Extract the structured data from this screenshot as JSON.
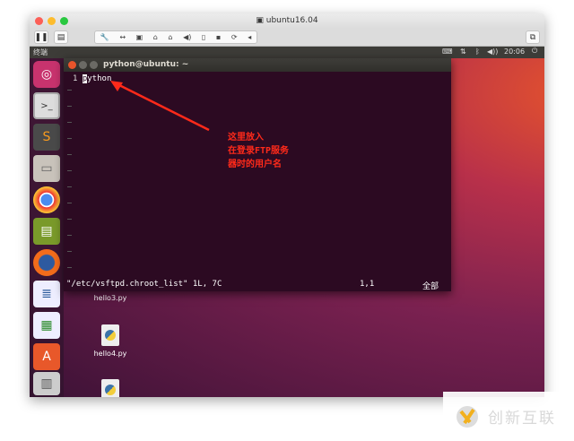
{
  "window": {
    "title": "ubuntu16.04"
  },
  "panel": {
    "app_name": "终端",
    "time": "20:06"
  },
  "terminal": {
    "title": "python@ubuntu: ~",
    "line_number": "1",
    "line_cursor_char": "p",
    "line_rest": "ython",
    "status_file": "\"/etc/vsftpd.chroot_list\" 1L, 7C",
    "status_pos": "1,1",
    "status_scroll": "全部"
  },
  "annotation": {
    "lines": [
      "这里放入",
      "在登录FTP服务",
      "器时的用户名"
    ],
    "color": "#ff2a1a"
  },
  "desktop_files": [
    "hello3.py",
    "hello4.py"
  ],
  "watermark": {
    "text": "创新互联"
  }
}
